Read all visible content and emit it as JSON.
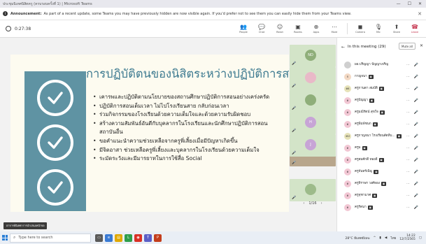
{
  "window": {
    "title": "ประชุมนิเทศนิสิตครู (ครบรอบครั้งที่ 1) | Microsoft Teams",
    "minimize": "—",
    "maximize": "☐",
    "close": "✕"
  },
  "announcement": {
    "label": "Announcement:",
    "text": "As part of a recent update, some Teams you may have previously hidden are now visible again. If you'd prefer not to see them you can easily hide them from your Teams view.",
    "close": "✕"
  },
  "toolbar": {
    "timer": "0:27:38",
    "tools": [
      {
        "name": "people",
        "icon": "👥",
        "label": "People"
      },
      {
        "name": "chat",
        "icon": "💬",
        "label": "Chat"
      },
      {
        "name": "react",
        "icon": "☺",
        "label": "React"
      },
      {
        "name": "rooms",
        "icon": "▣",
        "label": "Rooms"
      },
      {
        "name": "apps",
        "icon": "⊕",
        "label": "Apps"
      },
      {
        "name": "more",
        "icon": "⋯",
        "label": "More"
      },
      {
        "name": "camera",
        "icon": "◼",
        "label": "Camera"
      },
      {
        "name": "mic",
        "icon": "🎙",
        "label": "Mic"
      },
      {
        "name": "share",
        "icon": "⬆",
        "label": "Share"
      },
      {
        "name": "leave",
        "icon": "☎",
        "label": "Leave"
      }
    ]
  },
  "slide": {
    "title": "การปฏิบัติตนของนิสิตระหว่างปฏิบัติการสอน",
    "bullets": [
      {
        "text": "เคารพและปฏิบัติตามนโยบายของสถานศึกษาปฏิบัติการสอนอย่างเคร่งครัด",
        "cont": false
      },
      {
        "text": "ปฏิบัติการสอนเต็มเวลา ไม่ไปโรงเรียนสาย กลับก่อนเวลา",
        "cont": false
      },
      {
        "text": "ร่วมกิจกรรมของโรงเรียนด้วยความเต็มใจและด้วยความรับผิดชอบ",
        "cont": false
      },
      {
        "text": "สร้างความสัมพันธ์อันดีกับบุคลากรในโรงเรียนและนักศึกษาปฏิบัติการสอน",
        "cont": false
      },
      {
        "text": "สถาบันอื่น",
        "cont": true
      },
      {
        "text": "ขอคำแนะนำความช่วยเหลือจากครูพี่เลี้ยงเมื่อมีปัญหาเกิดขึ้น",
        "cont": false
      },
      {
        "text": "มีจิตอาสา ช่วยเหลือครูพี่เลี้ยงและบุคลากรในโรงเรียนด้วยความเต็มใจ",
        "cont": false
      },
      {
        "text": "ระมัดระวังและมีมารยาทในการใช้สื่อ Social",
        "cont": false
      }
    ]
  },
  "presenter": "อาจารย์นิเทศ การนำเสนอหน้าจอ",
  "strip": {
    "tiles": [
      {
        "initials": "ND",
        "color": "#8fae7a"
      },
      {
        "initials": "",
        "color": "#e9b9c8"
      },
      {
        "initials": "",
        "color": "#8fae7a"
      },
      {
        "initials": "H",
        "color": "#c7a4d6"
      },
      {
        "initials": "J",
        "color": "#c7a4d6"
      },
      {
        "initials": "",
        "color": "#b8a68c"
      },
      {
        "initials": "",
        "color": "#9dbb8a"
      }
    ],
    "pager": "1/16",
    "prev": "‹",
    "next": "›"
  },
  "panel": {
    "title": "In this meeting (29)",
    "mute_all": "Mute all",
    "participants": [
      {
        "initials": "",
        "name": "ผอ.ปริญญา ปัญญาเจริญ",
        "color": "#cfcfcf",
        "badge": false
      },
      {
        "initials": "ก",
        "name": "กาญจนา",
        "color": "#f3d9c4",
        "badge": true
      },
      {
        "initials": "คธ",
        "name": "ครูกานดา สมบัติ",
        "color": "#e6e2b8",
        "badge": true
      },
      {
        "initials": "ค",
        "name": "ครูปัญญา",
        "color": "#f2c7d4",
        "badge": true
      },
      {
        "initials": "ค",
        "name": "ครูมณีรัตน์ สุขใจ",
        "color": "#f2c7d4",
        "badge": true
      },
      {
        "initials": "ค",
        "name": "ครูพิมพ์ชนก",
        "color": "#f2c7d4",
        "badge": true
      },
      {
        "initials": "คป",
        "name": "ครูกาญจนา โรงเรียนสัตหีบ...",
        "color": "#e6e2b8",
        "badge": true
      },
      {
        "initials": "ค",
        "name": "ครูม",
        "color": "#f2c7d4",
        "badge": true
      },
      {
        "initials": "ค",
        "name": "ครูสมศักดิ์ ทองดี",
        "color": "#f2c7d4",
        "badge": true
      },
      {
        "initials": "ค",
        "name": "ครูจันทร์เพ็ญ",
        "color": "#f2c7d4",
        "badge": true
      },
      {
        "initials": "ค",
        "name": "ครูจิราพร วงศ์ทอง",
        "color": "#f2c7d4",
        "badge": true
      },
      {
        "initials": "ค",
        "name": "ครูจุฑามาศ",
        "color": "#f2c7d4",
        "badge": true
      },
      {
        "initials": "ค",
        "name": "ครูรัตนา",
        "color": "#f2c7d4",
        "badge": true
      }
    ]
  },
  "taskbar": {
    "search_placeholder": "Type here to search",
    "weather": "28°C มีแดดมีเมฆ",
    "lang": "ไทย",
    "time": "14:22",
    "date": "12/7/2565"
  }
}
